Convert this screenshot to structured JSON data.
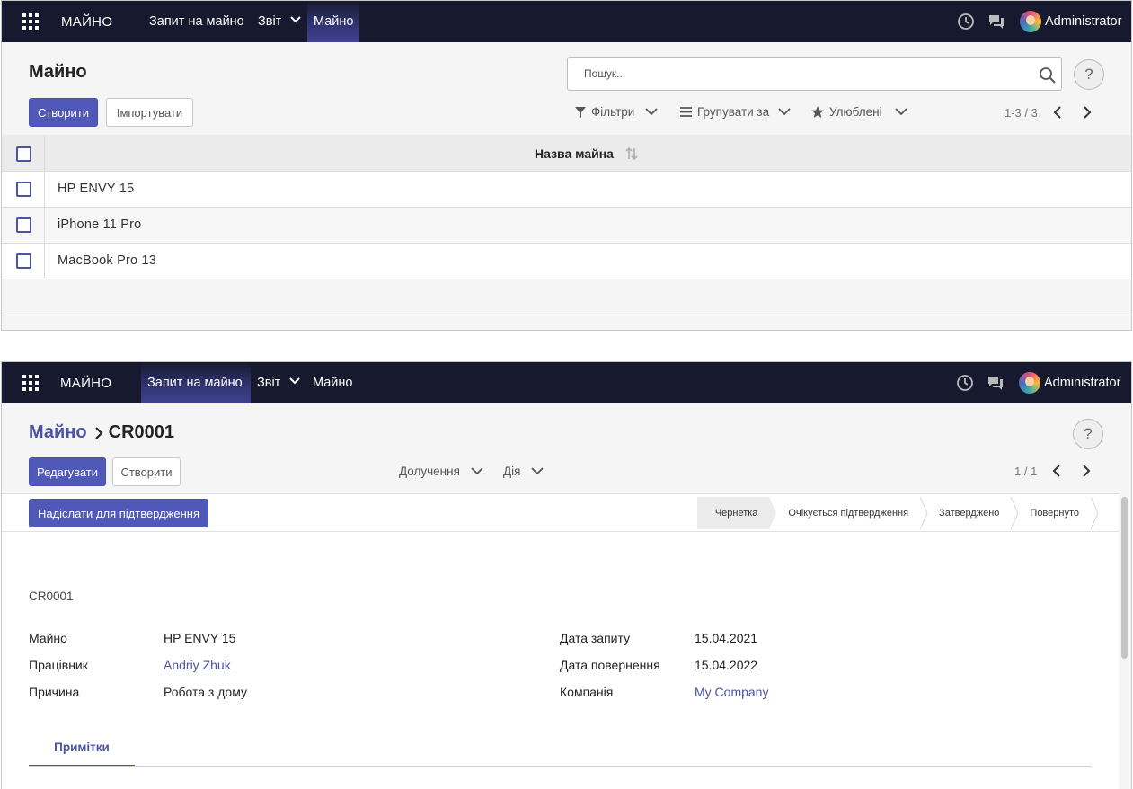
{
  "list_view": {
    "navbar": {
      "brand": "МАЙНО",
      "menu": [
        "Запит на майно",
        "Звіт",
        "Майно"
      ],
      "active": "Майно",
      "user": "Administrator"
    },
    "title": "Майно",
    "create_label": "Створити",
    "import_label": "Імпортувати",
    "search_placeholder": "Пошук...",
    "help_label": "?",
    "filters_label": "Фільтри",
    "group_label": "Групувати за",
    "favorites_label": "Улюблені",
    "pager": "1-3 / 3",
    "column_header": "Назва майна",
    "rows": [
      "HP ENVY 15",
      "iPhone 11 Pro",
      "MacBook Pro 13"
    ]
  },
  "form_view": {
    "navbar": {
      "brand": "МАЙНО",
      "menu": [
        "Запит на майно",
        "Звіт",
        "Майно"
      ],
      "active": "Запит на майно",
      "user": "Administrator"
    },
    "breadcrumb": {
      "parent": "Майно",
      "current": "CR0001"
    },
    "edit_label": "Редагувати",
    "create_label": "Створити",
    "received_label": "Долучення",
    "action_label": "Дія",
    "pager": "1 / 1",
    "help_label": "?",
    "submit_label": "Надіслати для підтвердження",
    "stages": [
      "Чернетка",
      "Очікується підтвердження",
      "Затверджено",
      "Повернуто"
    ],
    "current_stage": "Чернетка",
    "reference": "CR0001",
    "fields_left": [
      {
        "label": "Майно",
        "value": "HP ENVY 15"
      },
      {
        "label": "Працівник",
        "value": "Andriy Zhuk"
      },
      {
        "label": "Причина",
        "value": "Робота з дому"
      }
    ],
    "fields_right": [
      {
        "label": "Дата запиту",
        "value": "15.04.2021"
      },
      {
        "label": "Дата повернення",
        "value": "15.04.2022"
      },
      {
        "label": "Компанія",
        "value": "My Company"
      }
    ],
    "tab_notes": "Примітки"
  },
  "colors": {
    "navbar": "#171a2e",
    "primary": "#5159b8",
    "link": "#4c53a5"
  }
}
